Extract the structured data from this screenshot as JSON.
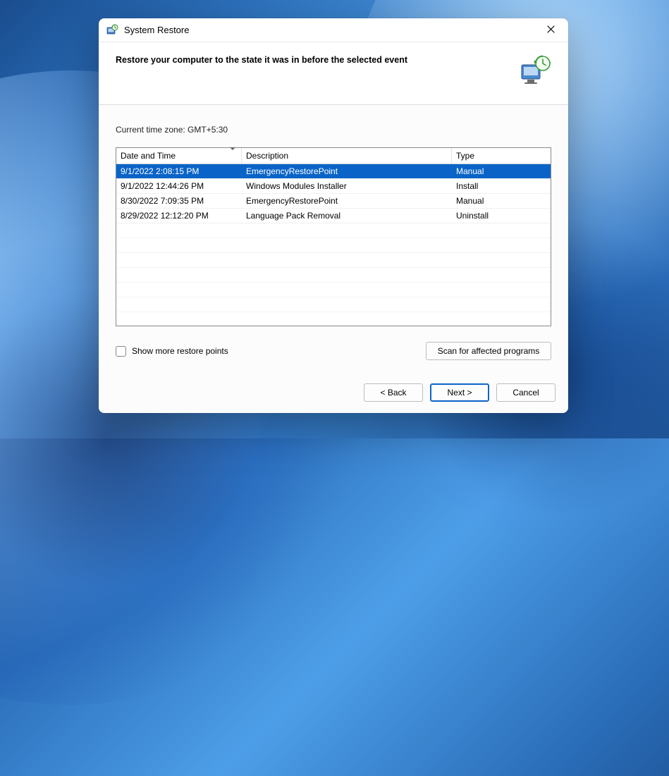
{
  "window": {
    "title": "System Restore"
  },
  "header": {
    "heading": "Restore your computer to the state it was in before the selected event"
  },
  "timezone_label": "Current time zone: GMT+5:30",
  "columns": {
    "datetime": "Date and Time",
    "description": "Description",
    "type": "Type"
  },
  "rows": [
    {
      "datetime": "9/1/2022 2:08:15 PM",
      "description": "EmergencyRestorePoint",
      "type": "Manual",
      "selected": true
    },
    {
      "datetime": "9/1/2022 12:44:26 PM",
      "description": "Windows Modules Installer",
      "type": "Install",
      "selected": false
    },
    {
      "datetime": "8/30/2022 7:09:35 PM",
      "description": "EmergencyRestorePoint",
      "type": "Manual",
      "selected": false
    },
    {
      "datetime": "8/29/2022 12:12:20 PM",
      "description": "Language Pack Removal",
      "type": "Uninstall",
      "selected": false
    }
  ],
  "show_more_label": "Show more restore points",
  "buttons": {
    "scan": "Scan for affected programs",
    "back": "< Back",
    "next": "Next >",
    "cancel": "Cancel"
  }
}
